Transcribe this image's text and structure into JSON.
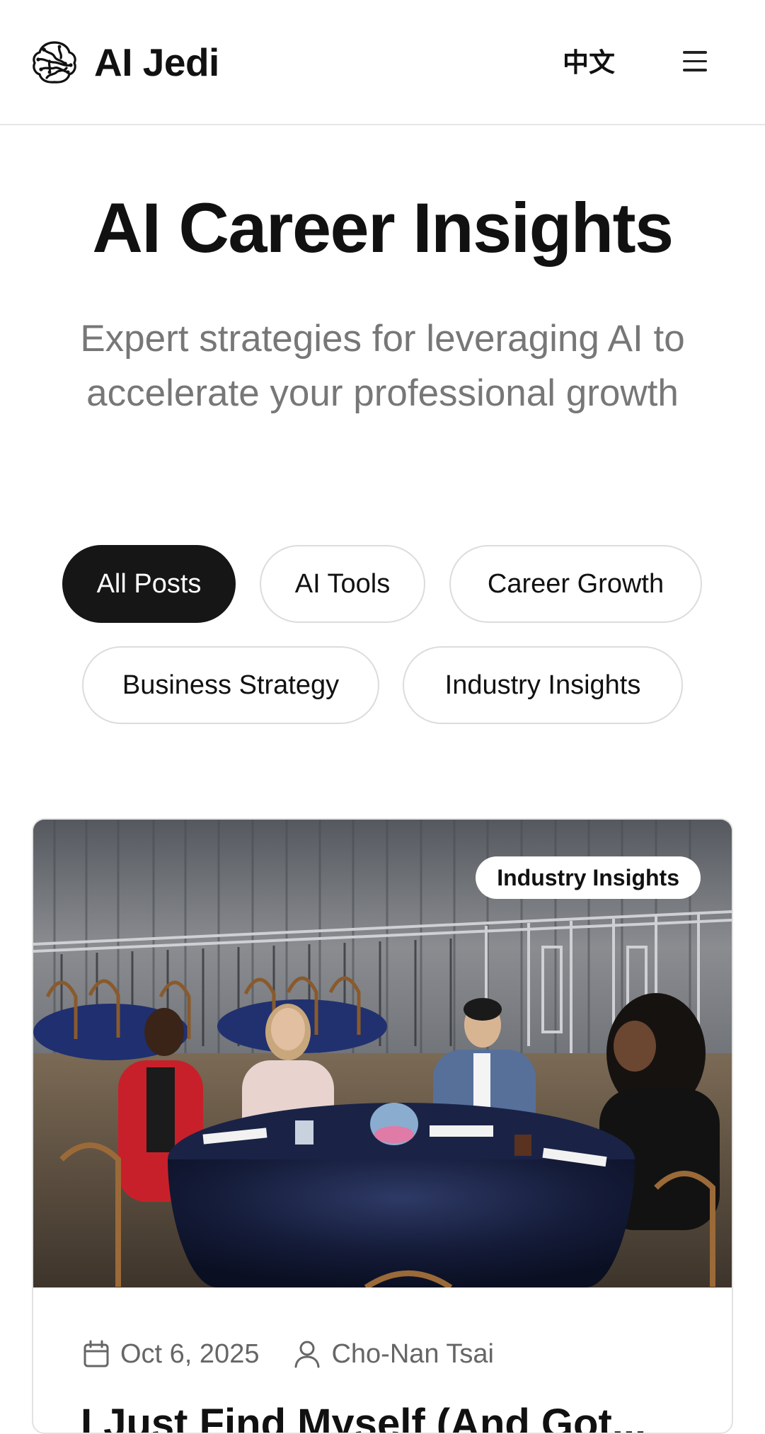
{
  "header": {
    "brand": "AI Jedi",
    "language_label": "中文",
    "logo_icon": "brain-circuit-icon",
    "menu_icon": "hamburger-menu-icon"
  },
  "hero": {
    "title": "AI Career Insights",
    "subtitle": "Expert strategies for leveraging AI to accelerate your professional growth"
  },
  "filters": [
    {
      "label": "All Posts",
      "active": true
    },
    {
      "label": "AI Tools",
      "active": false
    },
    {
      "label": "Career Growth",
      "active": false
    },
    {
      "label": "Business Strategy",
      "active": false
    },
    {
      "label": "Industry Insights",
      "active": false
    }
  ],
  "posts": [
    {
      "tag": "Industry Insights",
      "date": "Oct 6, 2025",
      "author": "Cho-Nan Tsai",
      "title": "I Just Find Myself (And Got...",
      "date_icon": "calendar-icon",
      "author_icon": "user-icon"
    }
  ],
  "colors": {
    "active_pill_bg": "#161616",
    "subtitle_text": "#777777",
    "meta_text": "#666666"
  }
}
